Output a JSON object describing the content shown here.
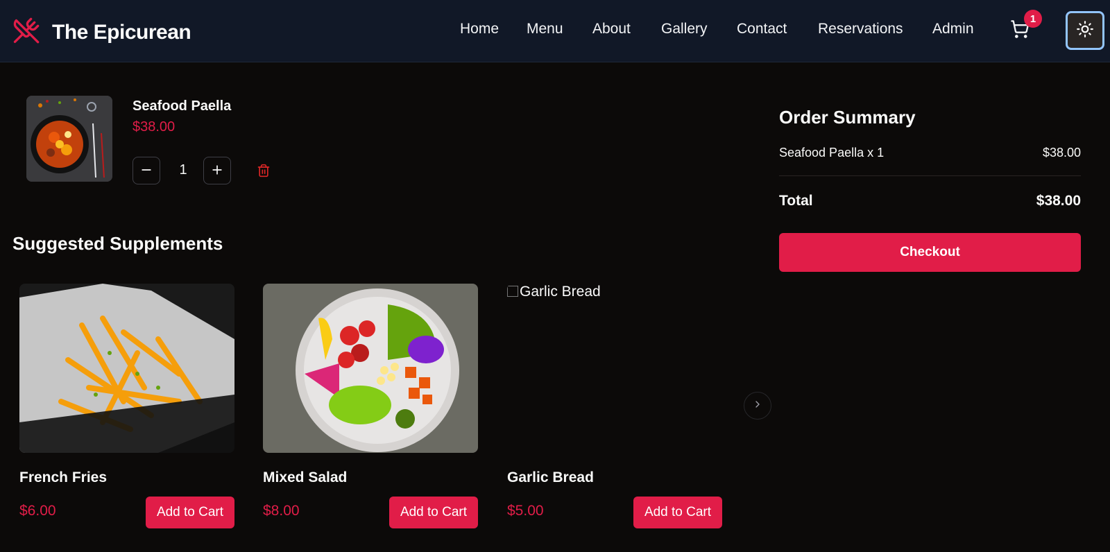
{
  "header": {
    "brand_name": "The Epicurean",
    "brand_icon": "utensils-crossed-icon",
    "nav": [
      {
        "label": "Home"
      },
      {
        "label": "Menu"
      },
      {
        "label": "About"
      },
      {
        "label": "Gallery"
      },
      {
        "label": "Contact"
      },
      {
        "label": "Reservations"
      },
      {
        "label": "Admin"
      }
    ],
    "cart_count": "1",
    "cart_icon": "shopping-cart-icon",
    "theme_icon": "sun-icon"
  },
  "cart": {
    "items": [
      {
        "name": "Seafood Paella",
        "price": "$38.00",
        "quantity": "1"
      }
    ]
  },
  "suggestions": {
    "title": "Suggested Supplements",
    "items": [
      {
        "name": "French Fries",
        "price": "$6.00",
        "button": "Add to Cart"
      },
      {
        "name": "Mixed Salad",
        "price": "$8.00",
        "button": "Add to Cart"
      },
      {
        "name": "Garlic Bread",
        "price": "$5.00",
        "button": "Add to Cart",
        "image_alt": "Garlic Bread"
      }
    ]
  },
  "summary": {
    "title": "Order Summary",
    "line_label": "Seafood Paella x 1",
    "line_value": "$38.00",
    "total_label": "Total",
    "total_value": "$38.00",
    "checkout_label": "Checkout"
  },
  "colors": {
    "accent": "#e11d48",
    "background": "#0c0a09",
    "header_bg": "#111827"
  }
}
